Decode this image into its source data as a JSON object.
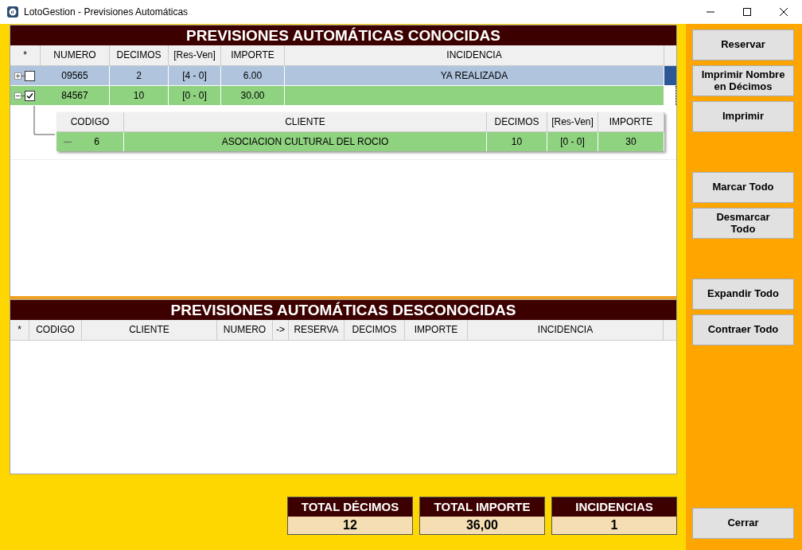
{
  "window": {
    "title": "LotoGestion - Previsiones Automáticas"
  },
  "known": {
    "title": "PREVISIONES AUTOMÁTICAS CONOCIDAS",
    "columns": [
      "*",
      "NUMERO",
      "DECIMOS",
      "[Res-Ven]",
      "IMPORTE",
      "INCIDENCIA"
    ],
    "rows": [
      {
        "numero": "09565",
        "decimos": "2",
        "res_ven": "[4 - 0]",
        "importe": "6.00",
        "incidencia": "YA REALIZADA",
        "selected": true,
        "checked": false,
        "expanded": false,
        "children": []
      },
      {
        "numero": "84567",
        "decimos": "10",
        "res_ven": "[0 - 0]",
        "importe": "30.00",
        "incidencia": "",
        "selected": false,
        "checked": true,
        "expanded": true,
        "detail_columns": [
          "CODIGO",
          "CLIENTE",
          "DECIMOS",
          "[Res-Ven]",
          "IMPORTE"
        ],
        "children": [
          {
            "codigo": "6",
            "cliente": "ASOCIACION CULTURAL DEL ROCIO",
            "decimos": "10",
            "res_ven": "[0 - 0]",
            "importe": "30"
          }
        ]
      }
    ]
  },
  "unknown": {
    "title": "PREVISIONES AUTOMÁTICAS DESCONOCIDAS",
    "columns": [
      "*",
      "CODIGO",
      "CLIENTE",
      "NUMERO",
      "->",
      "RESERVA",
      "DECIMOS",
      "IMPORTE",
      "INCIDENCIA"
    ]
  },
  "totals": [
    {
      "label": "TOTAL DÉCIMOS",
      "value": "12"
    },
    {
      "label": "TOTAL IMPORTE",
      "value": "36,00"
    },
    {
      "label": "INCIDENCIAS",
      "value": "1"
    }
  ],
  "button_groups": [
    [
      "Reservar",
      "Imprimir Nombre en Décimos",
      "Imprimir"
    ],
    [
      "Marcar Todo",
      "Desmarcar Todo"
    ],
    [
      "Expandir Todo",
      "Contraer Todo"
    ]
  ],
  "close_button": "Cerrar"
}
